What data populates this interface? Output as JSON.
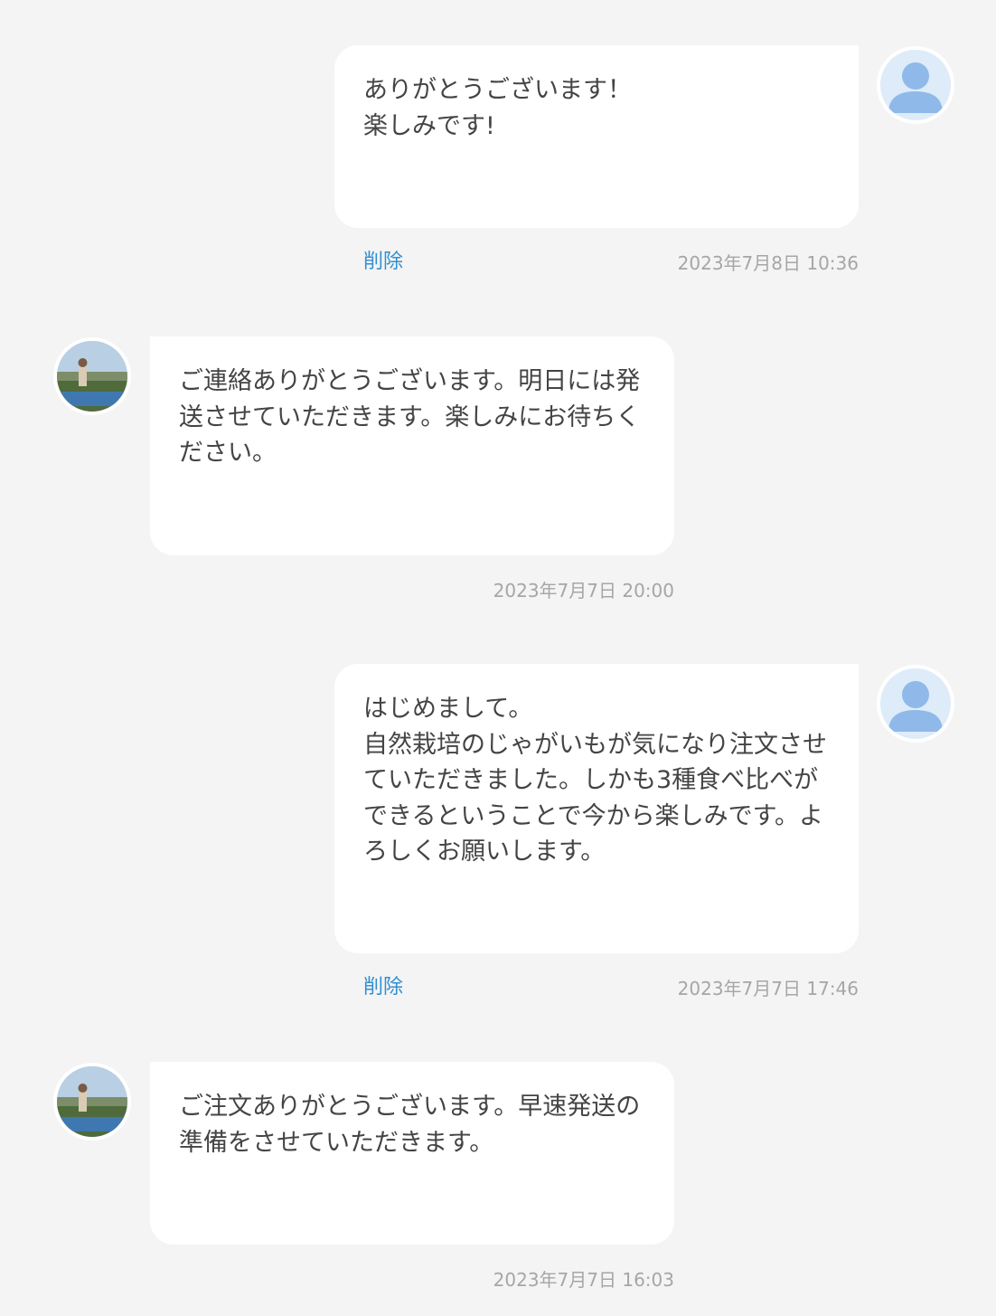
{
  "messages": [
    {
      "sender": "customer",
      "text": "ありがとうございます！\n楽しみです!",
      "delete_label": "削除",
      "timestamp": "2023年7月8日 10:36"
    },
    {
      "sender": "shop",
      "text": "ご連絡ありがとうございます。明日には発送させていただきます。楽しみにお待ちください。",
      "timestamp": "2023年7月7日 20:00"
    },
    {
      "sender": "customer",
      "text": "はじめまして。\n自然栽培のじゃがいもが気になり注文させていただきました。しかも3種食べ比べができるということで今から楽しみです。よろしくお願いします。",
      "delete_label": "削除",
      "timestamp": "2023年7月7日 17:46"
    },
    {
      "sender": "shop",
      "text": "ご注文ありがとうございます。早速発送の準備をさせていただきます。",
      "timestamp": "2023年7月7日 16:03"
    }
  ],
  "icons": {
    "customer_avatar": "default-user-avatar-icon",
    "shop_avatar": "shop-farm-photo-avatar"
  },
  "colors": {
    "background": "#f4f4f4",
    "bubble": "#ffffff",
    "text": "#444444",
    "delete_link": "#2f8fd1",
    "timestamp": "#a6a6a6",
    "avatar_user_bg": "#deebf9",
    "avatar_user_fg": "#8fb9e8"
  }
}
